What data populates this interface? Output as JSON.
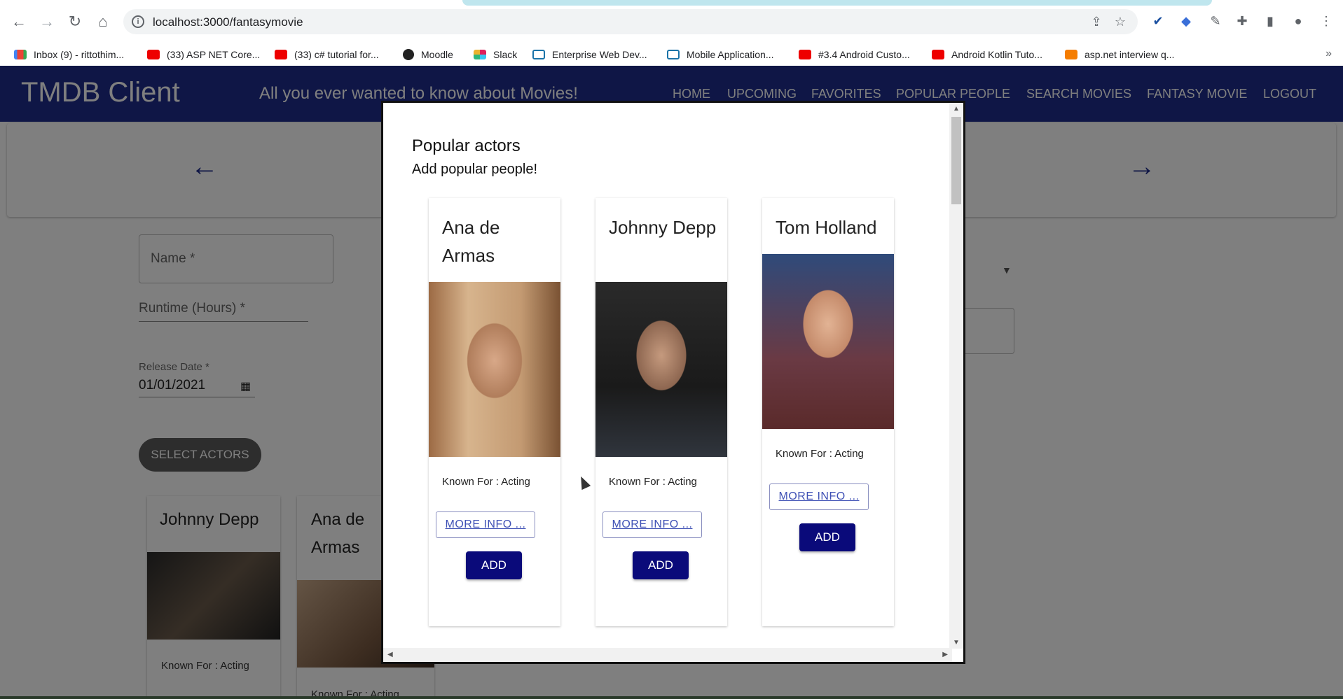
{
  "browser": {
    "url": "localhost:3000/fantasymovie",
    "bookmarks": [
      {
        "label": "Inbox (9) - rittothim...",
        "icon": "gmail"
      },
      {
        "label": "(33) ASP NET Core...",
        "icon": "youtube"
      },
      {
        "label": "(33) c# tutorial for...",
        "icon": "youtube"
      },
      {
        "label": "Moodle",
        "icon": "moodle"
      },
      {
        "label": "Slack",
        "icon": "slack"
      },
      {
        "label": "Enterprise Web Dev...",
        "icon": "text"
      },
      {
        "label": "Mobile Application...",
        "icon": "text"
      },
      {
        "label": "#3.4 Android Custo...",
        "icon": "youtube"
      },
      {
        "label": "Android Kotlin Tuto...",
        "icon": "youtube"
      },
      {
        "label": "asp.net interview q...",
        "icon": "blogger"
      }
    ],
    "more": "»"
  },
  "app": {
    "title": "TMDB Client",
    "subtitle": "All you ever wanted to know about Movies!",
    "menu": [
      "Home",
      "Upcoming",
      "Favorites",
      "Popular People",
      "Search Movies",
      "Fantasy Movie",
      "Logout"
    ],
    "prev_arrow": "←",
    "next_arrow": "→"
  },
  "form": {
    "name_label": "Name *",
    "runtime_label": "Runtime (Hours) *",
    "release_label": "Release Date *",
    "release_value": "01/01/2021",
    "select_actors": "SELECT ACTORS"
  },
  "selected_actors": [
    {
      "name": "Johnny Depp",
      "known_for": "Known For : Acting"
    },
    {
      "name": "Ana de Armas",
      "known_for": "Known For : Acting"
    }
  ],
  "modal": {
    "title": "Popular actors",
    "subtitle": "Add popular people!",
    "actors": [
      {
        "name": "Ana de Armas",
        "known_for": "Known For : Acting",
        "more": "MORE INFO ...",
        "add": "ADD"
      },
      {
        "name": "Johnny Depp",
        "known_for": "Known For : Acting",
        "more": "MORE INFO ...",
        "add": "ADD"
      },
      {
        "name": "Tom Holland",
        "known_for": "Known For : Acting",
        "more": "MORE INFO ...",
        "add": "ADD"
      }
    ]
  }
}
